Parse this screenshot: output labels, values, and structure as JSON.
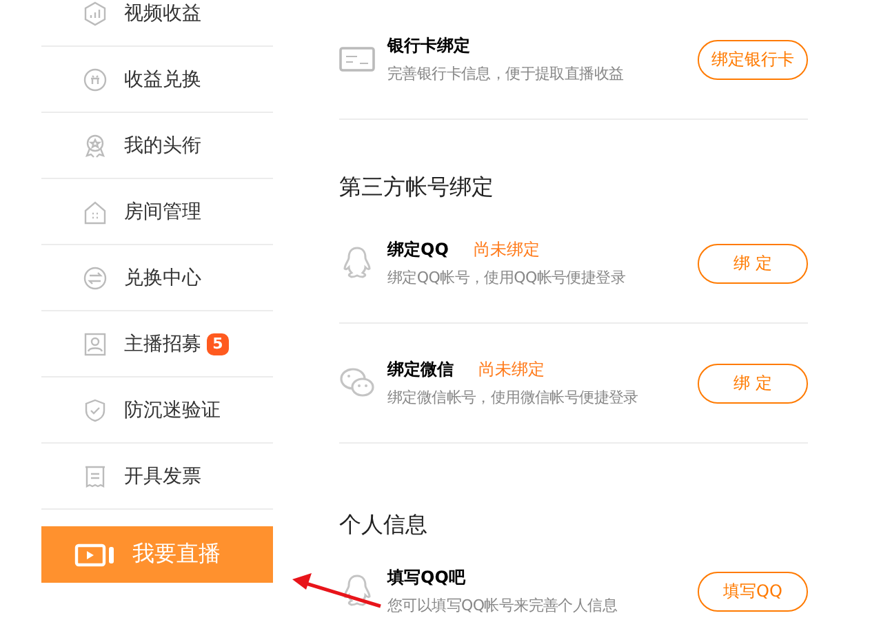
{
  "sidebar": {
    "items": [
      {
        "label": "视频收益"
      },
      {
        "label": "收益兑换"
      },
      {
        "label": "我的头衔"
      },
      {
        "label": "房间管理"
      },
      {
        "label": "兑换中心"
      },
      {
        "label": "主播招募",
        "badge": "5"
      },
      {
        "label": "防沉迷验证"
      },
      {
        "label": "开具发票"
      }
    ],
    "live_button": {
      "label": "我要直播"
    }
  },
  "bank_card": {
    "kind": "card",
    "title": "银行卡绑定",
    "description": "完善银行卡信息，便于提取直播收益",
    "button": "绑定银行卡"
  },
  "sections": [
    {
      "heading": "第三方帐号绑定",
      "items": [
        {
          "kind": "qq",
          "title": "绑定QQ",
          "status": "尚未绑定",
          "description": "绑定QQ帐号，使用QQ帐号便捷登录",
          "button": "绑 定"
        },
        {
          "kind": "wechat",
          "title": "绑定微信",
          "status": "尚未绑定",
          "description": "绑定微信帐号，使用微信帐号便捷登录",
          "button": "绑 定"
        }
      ]
    },
    {
      "heading": "个人信息",
      "items": [
        {
          "kind": "qq",
          "title": "填写QQ吧",
          "description": "您可以填写QQ帐号来完善个人信息",
          "button": "填写QQ"
        }
      ]
    }
  ]
}
